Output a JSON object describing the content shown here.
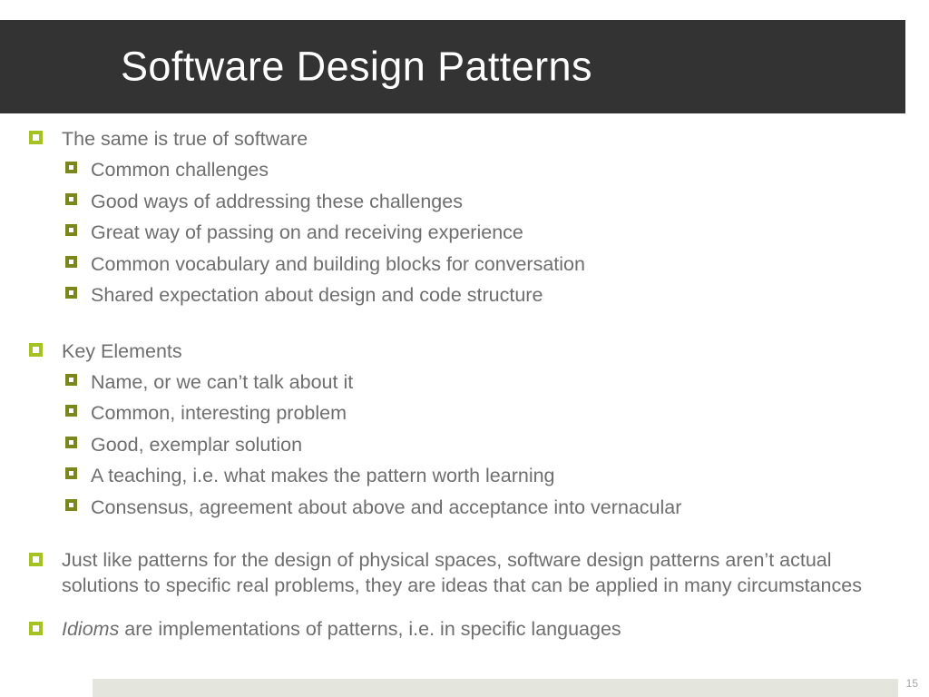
{
  "slide": {
    "title": "Software Design Patterns",
    "number": "15",
    "colors": {
      "title_bar": "#333333",
      "title_text": "#ffffff",
      "bullet_level1": "#a4c323",
      "bullet_level2": "#7b861f",
      "body_text": "#6e6e6e",
      "footer_bar": "#e4e6de",
      "slide_number": "#a6a6a6",
      "background": "#ffffff"
    }
  },
  "content": {
    "section1": {
      "heading": "The same is true of software",
      "items": [
        "Common challenges",
        "Good ways of addressing these challenges",
        "Great way of passing on and receiving experience",
        "Common vocabulary and building blocks for conversation",
        "Shared expectation about design and code structure"
      ]
    },
    "section2": {
      "heading": "Key Elements",
      "items": [
        "Name, or we can’t talk about it",
        "Common, interesting problem",
        "Good, exemplar solution",
        "A teaching, i.e. what makes the pattern worth learning",
        "Consensus, agreement about above and acceptance into vernacular"
      ]
    },
    "paragraph": "Just like patterns for the design of physical spaces, software design patterns aren’t actual solutions to specific real problems, they are ideas that can be applied in many circumstances",
    "closing": {
      "emphasis": "Idioms",
      "rest": " are implementations of patterns, i.e. in specific languages"
    }
  }
}
